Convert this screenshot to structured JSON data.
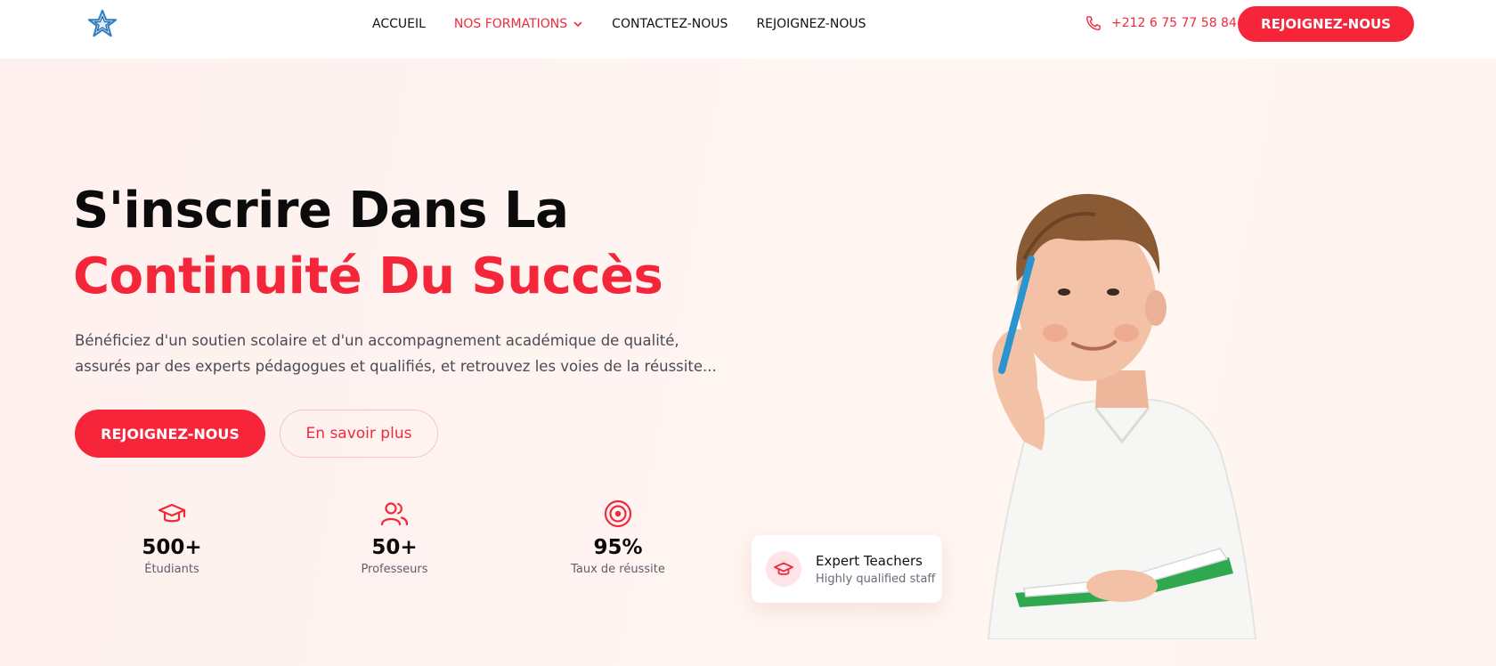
{
  "nav": {
    "links": [
      {
        "label": "ACCUEIL"
      },
      {
        "label": "NOS FORMATIONS"
      },
      {
        "label": "CONTACTEZ-NOUS"
      },
      {
        "label": "REJOIGNEZ-NOUS"
      }
    ],
    "phone": "+212 6 75 77 58 84",
    "cta_label": "REJOIGNEZ-NOUS"
  },
  "hero": {
    "title_line1": "S'inscrire Dans La",
    "title_line2": "Continuité Du Succès",
    "description": "Bénéficiez d'un soutien scolaire et d'un accompagnement académique de qualité, assurés par des experts pédagogues et qualifiés, et retrouvez les voies de la réussite...",
    "primary_button": "REJOIGNEZ-NOUS",
    "secondary_button": "En savoir plus",
    "stats": [
      {
        "icon": "graduation-cap-icon",
        "value": "500+",
        "label": "Étudiants"
      },
      {
        "icon": "users-icon",
        "value": "50+",
        "label": "Professeurs"
      },
      {
        "icon": "target-icon",
        "value": "95%",
        "label": "Taux de réussite"
      }
    ],
    "card": {
      "icon": "graduation-cap-icon",
      "title": "Expert Teachers",
      "subtitle": "Highly qualified staff"
    }
  },
  "colors": {
    "accent": "#f7253a",
    "hero_background": "#fff4f2",
    "text_dark": "#0b0b0b"
  }
}
